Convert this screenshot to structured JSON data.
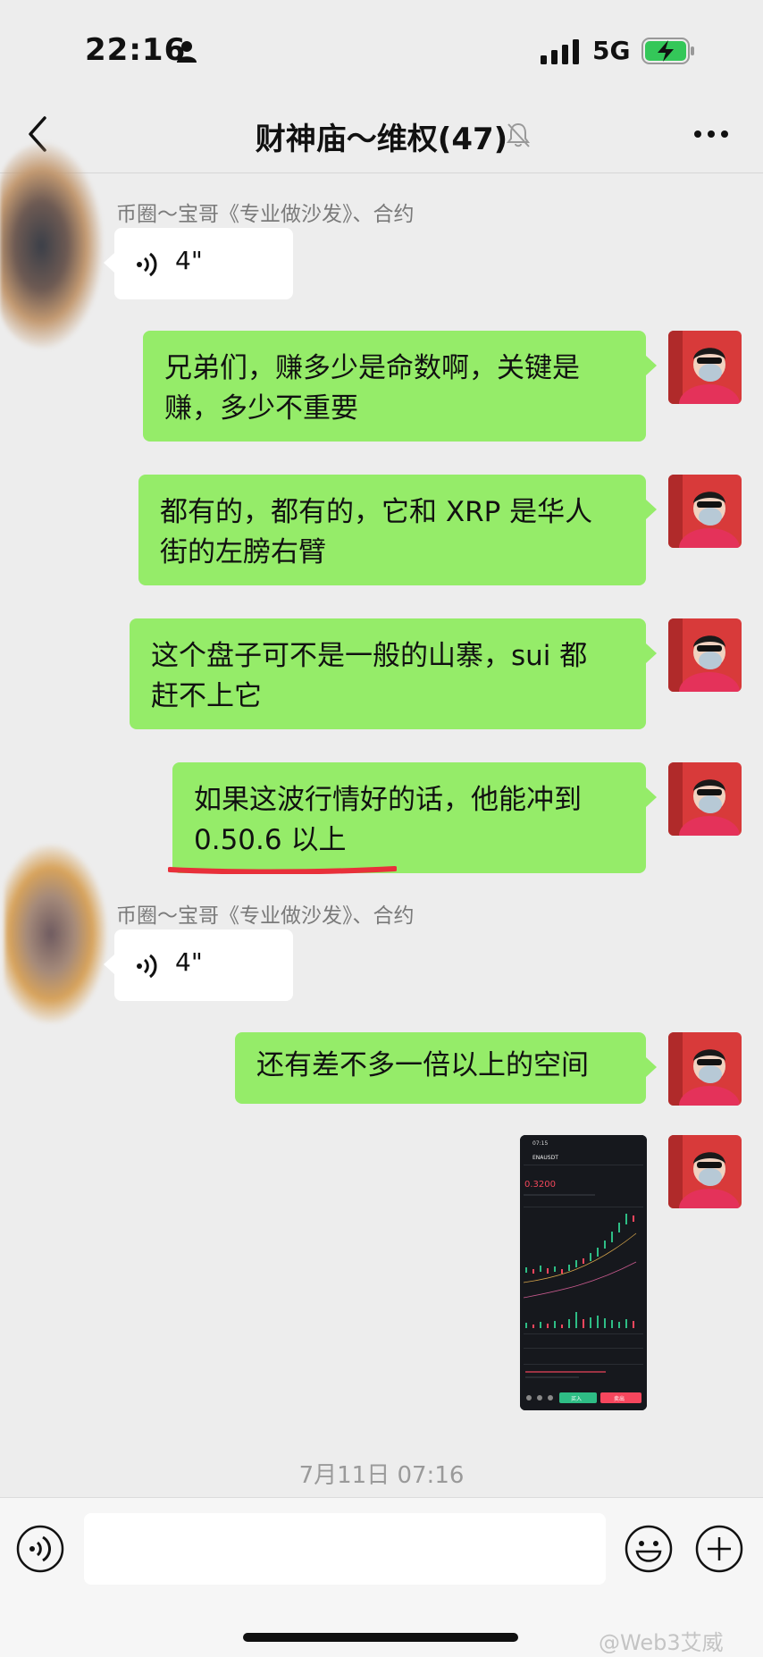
{
  "status_bar": {
    "time": "22:16",
    "network": "5G",
    "icons": [
      "person-icon",
      "signal-icon",
      "battery-charging-icon"
    ]
  },
  "nav": {
    "title": "财神庙～维权(47)",
    "icons": [
      "back-icon",
      "mute-bell-icon",
      "more-icon"
    ]
  },
  "messages": [
    {
      "type": "voice",
      "side": "left",
      "sender": "币圈～宝哥《专业做沙发》、合约",
      "duration": "4\""
    },
    {
      "type": "text",
      "side": "right",
      "text": "兄弟们，赚多少是命数啊，关键是\n赚，多少不重要"
    },
    {
      "type": "text",
      "side": "right",
      "text": "都有的，都有的，它和 XRP 是华人\n街的左膀右臂"
    },
    {
      "type": "text",
      "side": "right",
      "text": "这个盘子可不是一般的山寨，sui 都\n赶不上它"
    },
    {
      "type": "text",
      "side": "right",
      "text": "如果这波行情好的话，他能冲到\n0.50.6 以上"
    },
    {
      "type": "voice",
      "side": "left",
      "sender": "币圈～宝哥《专业做沙发》、合约",
      "duration": "4\""
    },
    {
      "type": "text",
      "side": "right",
      "text": "还有差不多一倍以上的空间"
    },
    {
      "type": "image",
      "side": "right",
      "image": {
        "time": "07:15",
        "symbol": "ENAUSDT",
        "price": "0.3200",
        "buy": "买入",
        "sell": "卖出"
      }
    }
  ],
  "timestamp": "7月11日 07:16",
  "input": {
    "placeholder": "",
    "value": ""
  },
  "watermark": "@Web3艾威",
  "colors": {
    "background": "#ededed",
    "self_bubble": "#95ec69",
    "other_bubble": "#ffffff",
    "underline": "#e8303a"
  }
}
